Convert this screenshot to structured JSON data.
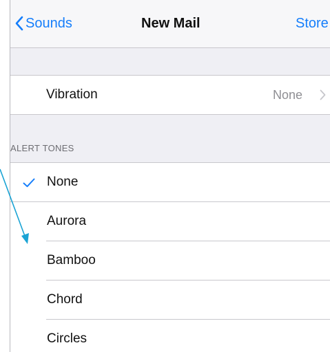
{
  "navbar": {
    "back_label": "Sounds",
    "title": "New Mail",
    "right_label": "Store"
  },
  "vibration": {
    "label": "Vibration",
    "value": "None"
  },
  "alert_tones": {
    "header": "ALERT TONES",
    "selected": "None",
    "items": [
      "None",
      "Aurora",
      "Bamboo",
      "Chord",
      "Circles"
    ]
  },
  "colors": {
    "accent": "#157efb",
    "annotation_arrow": "#1aa3d4"
  }
}
